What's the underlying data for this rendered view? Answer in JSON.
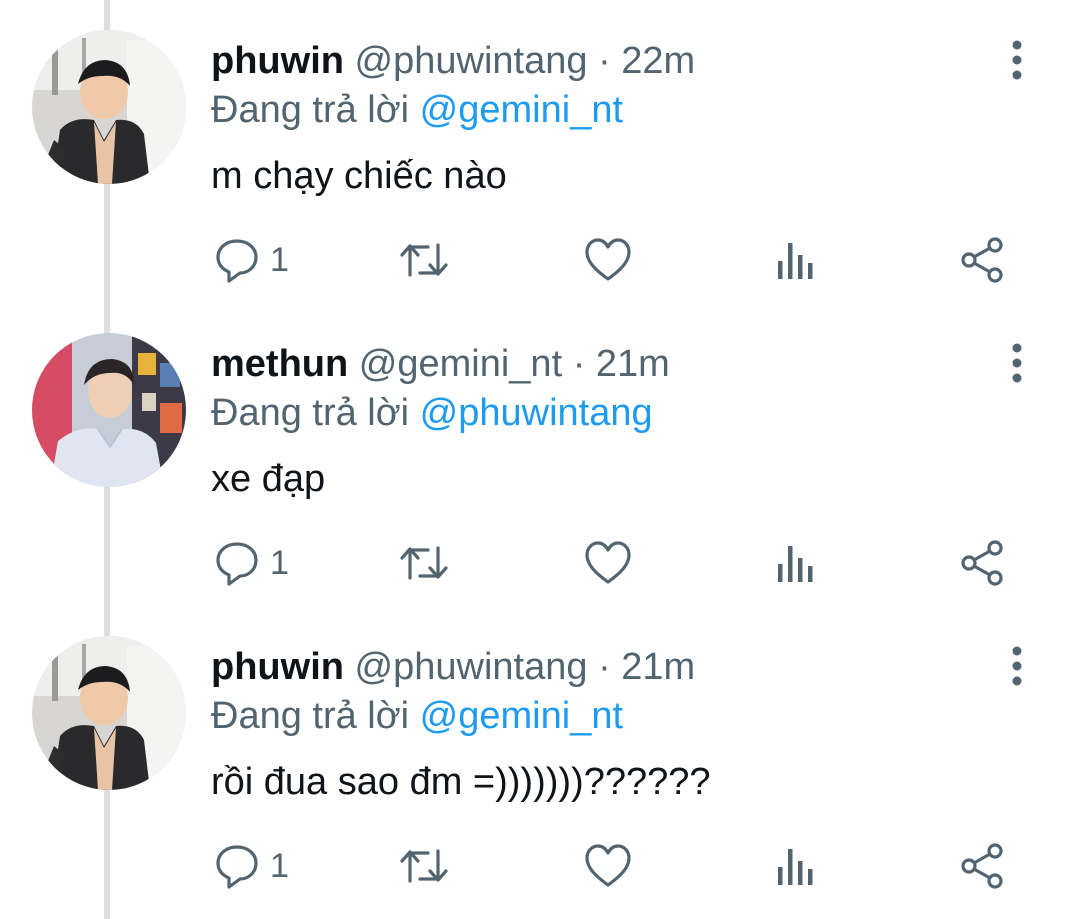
{
  "tweets": [
    {
      "display_name": "phuwin",
      "handle": "@phuwintang",
      "separator": "·",
      "time": "22m",
      "reply_prefix": "Đang trả lời",
      "reply_to": "@gemini_nt",
      "text": "m chạy chiếc nào",
      "reply_count": "1",
      "avatar": "phuwin-avatar"
    },
    {
      "display_name": "methun",
      "handle": "@gemini_nt",
      "separator": "·",
      "time": "21m",
      "reply_prefix": "Đang trả lời",
      "reply_to": "@phuwintang",
      "text": "xe đạp",
      "reply_count": "1",
      "avatar": "methun-avatar"
    },
    {
      "display_name": "phuwin",
      "handle": "@phuwintang",
      "separator": "·",
      "time": "21m",
      "reply_prefix": "Đang trả lời",
      "reply_to": "@gemini_nt",
      "text": "rồi đua sao đm =)))))))??????",
      "reply_count": "1",
      "avatar": "phuwin-avatar"
    }
  ],
  "icons": {
    "more": "more-vertical-icon",
    "reply": "reply-bubble-icon",
    "retweet": "retweet-icon",
    "like": "heart-icon",
    "views": "analytics-icon",
    "share": "share-icon"
  },
  "colors": {
    "text": "#0f1419",
    "secondary": "#536471",
    "mention": "#1d9bf0",
    "thread_line": "#dcdfe2"
  }
}
